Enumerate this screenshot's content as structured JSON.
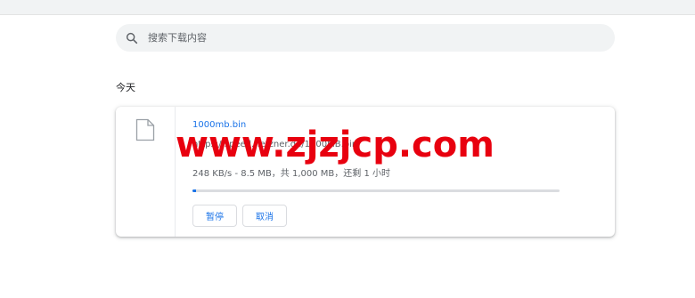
{
  "search": {
    "placeholder": "搜索下载内容",
    "value": ""
  },
  "section": {
    "label": "今天"
  },
  "download": {
    "file_name": "1000mb.bin",
    "url": "https://speed.hetzner.de/1000MB.bin",
    "status": "248 KB/s - 8.5 MB，共 1,000 MB，还剩 1 小时",
    "progress": 0.0085,
    "pause_label": "暂停",
    "cancel_label": "取消"
  },
  "watermark": {
    "text": "www.zjzjcp.com"
  },
  "colors": {
    "accent": "#1a73e8",
    "watermark": "#e8000f"
  },
  "icons": {
    "search": "search-icon",
    "file": "file-icon"
  }
}
